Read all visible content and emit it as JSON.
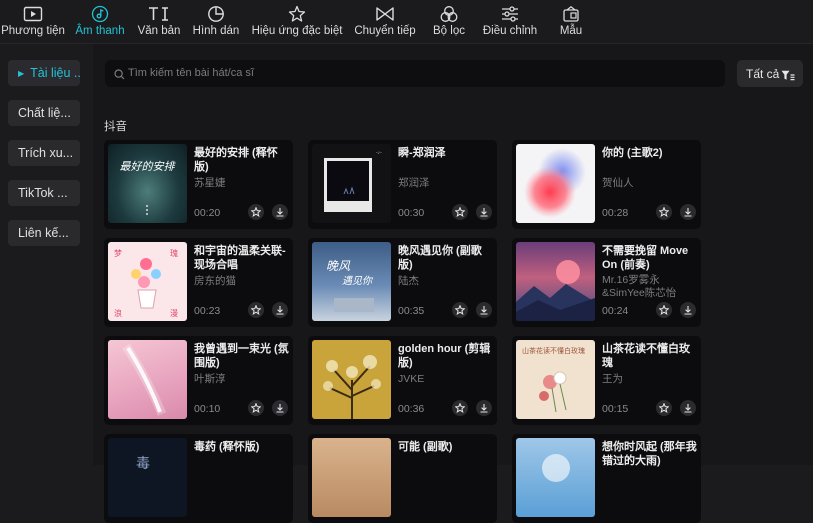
{
  "toolbar": {
    "items": [
      {
        "label": "Phương tiện",
        "icon": "media-icon"
      },
      {
        "label": "Âm thanh",
        "icon": "audio-icon"
      },
      {
        "label": "Văn bản",
        "icon": "text-icon"
      },
      {
        "label": "Hình dán",
        "icon": "sticker-icon"
      },
      {
        "label": "Hiệu ứng đặc biệt",
        "icon": "effects-icon"
      },
      {
        "label": "Chuyển tiếp",
        "icon": "transition-icon"
      },
      {
        "label": "Bộ lọc",
        "icon": "filter-icon"
      },
      {
        "label": "Điều chỉnh",
        "icon": "adjust-icon"
      },
      {
        "label": "Mẫu",
        "icon": "template-icon"
      }
    ],
    "active": "Âm thanh",
    "accent": "#22c3d6"
  },
  "sidebar": {
    "items": [
      {
        "label": "Tài liệu ..."
      },
      {
        "label": "Chất liệ..."
      },
      {
        "label": "Trích xu..."
      },
      {
        "label": "TikTok ..."
      },
      {
        "label": "Liên kế..."
      }
    ]
  },
  "search": {
    "placeholder": "Tìm kiếm tên bài hát/ca sĩ"
  },
  "filter": {
    "label": "Tất cả"
  },
  "section": {
    "title": "抖音"
  },
  "songs": [
    {
      "title": "最好的安排 (释怀版)",
      "artist": "苏星婕",
      "duration": "00:20"
    },
    {
      "title": "瞬-郑润泽",
      "artist": "郑润泽",
      "duration": "00:30"
    },
    {
      "title": "你的 (主歌2)",
      "artist": "贺仙人",
      "duration": "00:28"
    },
    {
      "title": "和宇宙的温柔关联-现场合唱",
      "artist": "房东的猫",
      "duration": "00:23"
    },
    {
      "title": "晚风遇见你 (副歌版)",
      "artist": "陆杰",
      "duration": "00:35"
    },
    {
      "title": "不需要挽留 Move On (前奏)",
      "artist": "Mr.16罗雾永&SimYee陈芯怡",
      "duration": "00:24"
    },
    {
      "title": "我曾遇到一束光 (氛围版)",
      "artist": "叶斯淳",
      "duration": "00:10"
    },
    {
      "title": "golden hour (剪辑版)",
      "artist": "JVKE",
      "duration": "00:36"
    },
    {
      "title": "山茶花读不懂白玫瑰",
      "artist": "王为",
      "duration": "00:15"
    },
    {
      "title": "毒药 (释怀版)",
      "artist": "",
      "duration": ""
    },
    {
      "title": "可能 (副歌)",
      "artist": "",
      "duration": ""
    },
    {
      "title": "想你时风起 (那年我错过的大雨)",
      "artist": "",
      "duration": ""
    }
  ]
}
